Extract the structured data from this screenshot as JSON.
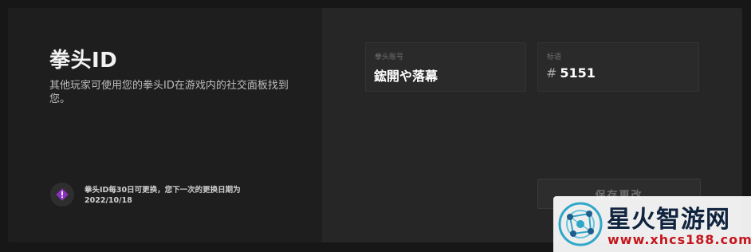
{
  "profile": {
    "title": "拳头ID",
    "description": "其他玩家可使用您的拳头ID在游戏内的社交面板找到您。",
    "notice": "拳头ID每30日可更换，您下一次的更换日期为2022/10/18"
  },
  "form": {
    "name_label": "拳头账号",
    "name_value": "鋐開や落幕",
    "tag_label": "标语",
    "tag_prefix": "#",
    "tag_value": "5151",
    "save_label": "保存更改"
  },
  "watermark": {
    "site_name": "星火智游网",
    "site_url": "www.xhcs188.com"
  },
  "colors": {
    "accent_purple": "#8a2fbf",
    "panel_left": "#1e1e1e",
    "panel_right": "#262626",
    "watermark_navy": "#10233f",
    "watermark_red": "#c4161c"
  },
  "icons": {
    "notice": "warning-diamond-icon",
    "watermark_logo": "network-globe-icon"
  }
}
